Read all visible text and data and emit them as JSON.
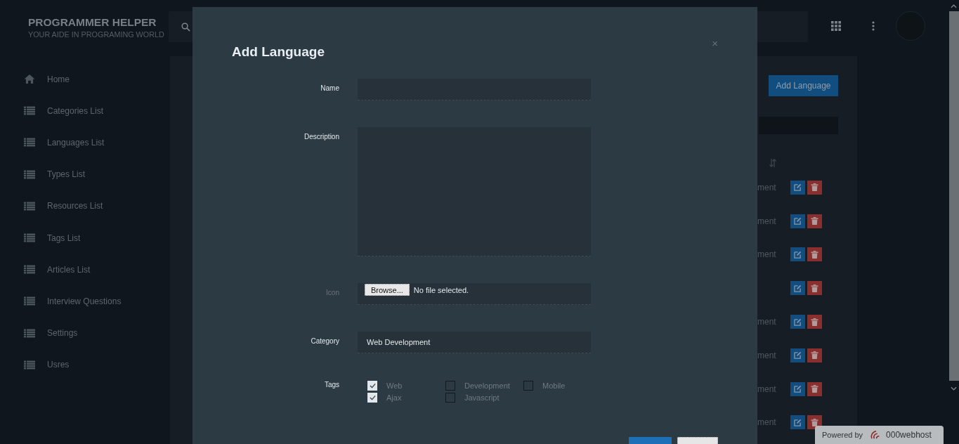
{
  "brand": {
    "title": "PROGRAMMER HELPER",
    "tagline": "YOUR AIDE IN PROGRAMING WORLD"
  },
  "sidebar": {
    "items": [
      {
        "label": "Home",
        "kind": "home"
      },
      {
        "label": "Categories List",
        "kind": "list"
      },
      {
        "label": "Languages List",
        "kind": "list"
      },
      {
        "label": "Types List",
        "kind": "list"
      },
      {
        "label": "Resources List",
        "kind": "list"
      },
      {
        "label": "Tags List",
        "kind": "list"
      },
      {
        "label": "Articles List",
        "kind": "list"
      },
      {
        "label": "Interview Questions",
        "kind": "list"
      },
      {
        "label": "Settings",
        "kind": "list"
      },
      {
        "label": "Usres",
        "kind": "list"
      }
    ]
  },
  "page": {
    "add_button": "Add Language",
    "rows": [
      {
        "text": "ment"
      },
      {
        "text": "ment"
      },
      {
        "text": "ment"
      },
      {},
      {
        "text": "ment"
      },
      {
        "text": "ment"
      },
      {
        "text": "ment"
      },
      {
        "text": "ment"
      }
    ]
  },
  "modal": {
    "title": "Add Language",
    "close": "×",
    "fields": [
      {
        "kind": "text",
        "label": "Name",
        "muted": false
      },
      {
        "kind": "textarea",
        "label": "Description",
        "muted": false
      },
      {
        "kind": "file",
        "label": "Icon",
        "muted": true,
        "button": "Browse...",
        "value": "No file selected."
      },
      {
        "kind": "select",
        "label": "Category",
        "muted": false,
        "value": "Web Development"
      },
      {
        "kind": "tags",
        "label": "Tags",
        "muted": false,
        "options": [
          {
            "label": "Web",
            "checked": true
          },
          {
            "label": "Development",
            "checked": false
          },
          {
            "label": "Mobile",
            "checked": false
          },
          {
            "label": "Ajax",
            "checked": true
          },
          {
            "label": "Javascript",
            "checked": false
          }
        ]
      }
    ]
  },
  "badge": {
    "prefix": "Powered by",
    "name": "000webhost"
  }
}
